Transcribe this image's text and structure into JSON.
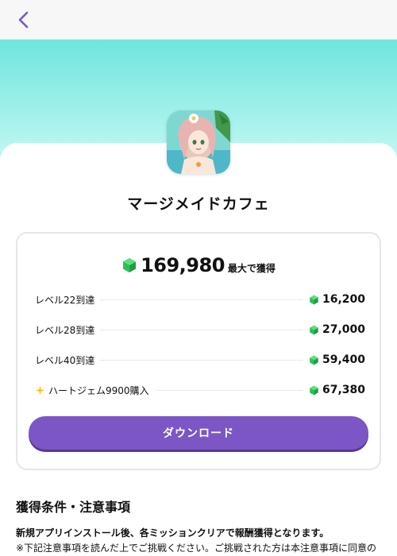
{
  "nav": {
    "back_icon": "chevron-left-icon",
    "accent": "#7b56c4"
  },
  "app": {
    "title": "マージメイドカフェ",
    "icon": "app-icon-anime-girl"
  },
  "rewards": {
    "total": "169,980",
    "total_suffix": "最大で獲得",
    "gem_icon": "green-gem-icon",
    "items": [
      {
        "label": "レベル22到達",
        "value": "16,200"
      },
      {
        "label": "レベル28到達",
        "value": "27,000"
      },
      {
        "label": "レベル40到達",
        "value": "59,400"
      },
      {
        "label": "ハートジェム9900購入",
        "value": "67,380",
        "icon": "sparkle-icon"
      }
    ]
  },
  "download_label": "ダウンロード",
  "conditions": {
    "title": "獲得条件・注意事項",
    "lead": "新規アプリインストール後、各ミッションクリアで報酬獲得となります。",
    "note": "※下記注意事項を読んだ上でご挑戦ください。ご挑戦された方は本注意事項に同意の"
  },
  "colors": {
    "hero": "#6fe5dc",
    "button": "#7b56c4",
    "gem": "#22b14c"
  }
}
